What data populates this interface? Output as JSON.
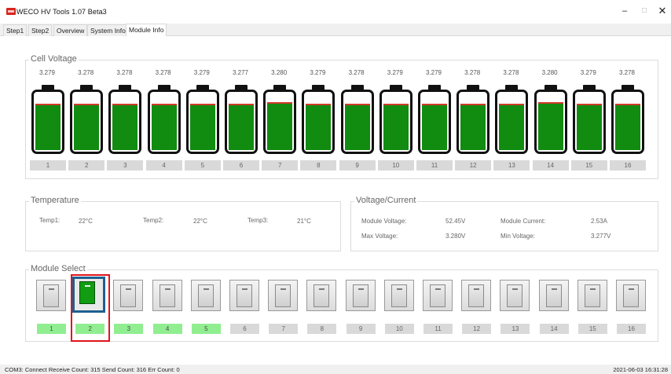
{
  "window": {
    "title": "WECO HV Tools 1.07 Beta3",
    "minimize": "–",
    "maximize": "□",
    "close": "✕"
  },
  "tabs": [
    "Step1",
    "Step2",
    "Overview",
    "System Info",
    "Module Info"
  ],
  "active_tab": "Module Info",
  "cell_voltage": {
    "title": "Cell Voltage",
    "cells": [
      {
        "num": "1",
        "voltage": "3.279",
        "level": 0.77
      },
      {
        "num": "2",
        "voltage": "3.278",
        "level": 0.77
      },
      {
        "num": "3",
        "voltage": "3.278",
        "level": 0.77
      },
      {
        "num": "4",
        "voltage": "3.278",
        "level": 0.77
      },
      {
        "num": "5",
        "voltage": "3.279",
        "level": 0.77
      },
      {
        "num": "6",
        "voltage": "3.277",
        "level": 0.77
      },
      {
        "num": "7",
        "voltage": "3.280",
        "level": 0.8
      },
      {
        "num": "8",
        "voltage": "3.279",
        "level": 0.77
      },
      {
        "num": "9",
        "voltage": "3.278",
        "level": 0.77
      },
      {
        "num": "10",
        "voltage": "3.279",
        "level": 0.77
      },
      {
        "num": "11",
        "voltage": "3.279",
        "level": 0.77
      },
      {
        "num": "12",
        "voltage": "3.278",
        "level": 0.77
      },
      {
        "num": "13",
        "voltage": "3.278",
        "level": 0.77
      },
      {
        "num": "14",
        "voltage": "3.280",
        "level": 0.8
      },
      {
        "num": "15",
        "voltage": "3.279",
        "level": 0.77
      },
      {
        "num": "16",
        "voltage": "3.278",
        "level": 0.77
      }
    ],
    "fill_color": "#118c11",
    "level_line_color": "#d03a2c"
  },
  "temperature": {
    "title": "Temperature",
    "items": [
      {
        "label": "Temp1:",
        "value": "22°C"
      },
      {
        "label": "Temp2:",
        "value": "22°C"
      },
      {
        "label": "Temp3:",
        "value": "21°C"
      }
    ]
  },
  "voltage_current": {
    "title": "Voltage/Current",
    "module_voltage_label": "Module Voltage:",
    "module_voltage": "52.45V",
    "module_current_label": "Module Current:",
    "module_current": "2.53A",
    "max_voltage_label": "Max Voltage:",
    "max_voltage": "3.280V",
    "min_voltage_label": "Min Voltage:",
    "min_voltage": "3.277V"
  },
  "module_select": {
    "title": "Module Select",
    "selected": "2",
    "modules": [
      {
        "num": "1",
        "online": true
      },
      {
        "num": "2",
        "online": true
      },
      {
        "num": "3",
        "online": true
      },
      {
        "num": "4",
        "online": true
      },
      {
        "num": "5",
        "online": true
      },
      {
        "num": "6",
        "online": false
      },
      {
        "num": "7",
        "online": false
      },
      {
        "num": "8",
        "online": false
      },
      {
        "num": "9",
        "online": false
      },
      {
        "num": "10",
        "online": false
      },
      {
        "num": "11",
        "online": false
      },
      {
        "num": "12",
        "online": false
      },
      {
        "num": "13",
        "online": false
      },
      {
        "num": "14",
        "online": false
      },
      {
        "num": "15",
        "online": false
      },
      {
        "num": "16",
        "online": false
      }
    ],
    "online_color": "#90ee90",
    "selection_color": "#e0141e"
  },
  "status": {
    "left": "COM3: Connect  Receive Count: 315  Send Count: 316  Err Count: 0",
    "right": "2021-06-03 16:31:28"
  }
}
